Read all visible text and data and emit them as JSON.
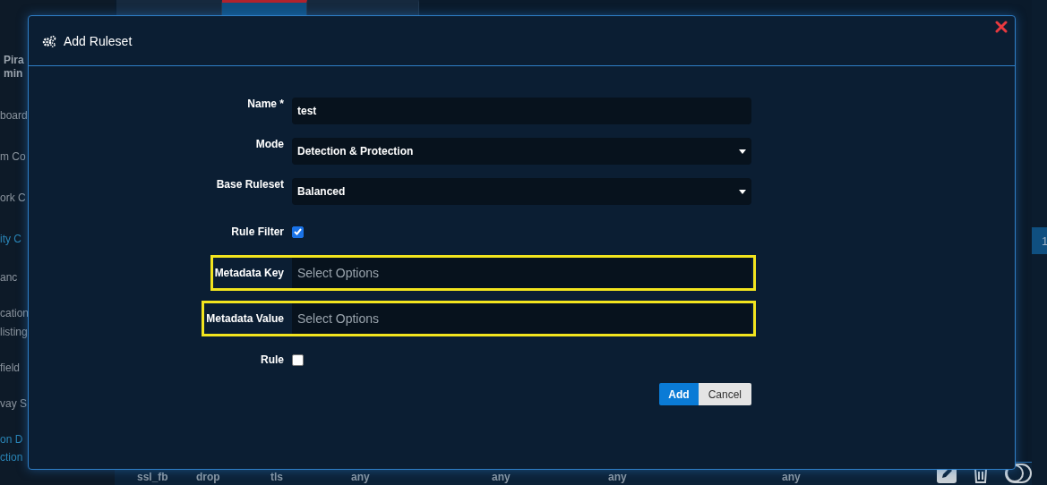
{
  "tabs": [
    {
      "selected": false
    },
    {
      "selected": true
    },
    {
      "selected": false
    }
  ],
  "sidebar": {
    "profile": [
      "Pira",
      "min"
    ],
    "items": [
      {
        "label": "board",
        "active": false
      },
      {
        "label": "m Co",
        "active": false
      },
      {
        "label": "ork C",
        "active": false
      },
      {
        "label": "ity C",
        "active": true
      },
      {
        "label": "anc",
        "active": false
      },
      {
        "label": "cation",
        "active": false
      },
      {
        "label": "listing",
        "active": false
      },
      {
        "label": "field",
        "active": false
      },
      {
        "label": "vay S",
        "active": false
      },
      {
        "label": "on D",
        "active": true
      },
      {
        "label": "ction",
        "active": true
      }
    ]
  },
  "table": {
    "rows": [
      {
        "cells": [
          "ssl_fb",
          "drop",
          "tls",
          "any",
          "any",
          "any",
          "any"
        ],
        "enabled": false
      }
    ]
  },
  "pagination": {
    "pages": [
      {
        "label": "1",
        "selected": true
      }
    ]
  },
  "modal": {
    "title": "Add Ruleset",
    "fields": [
      {
        "kind": "text",
        "label": "Name *",
        "value": "test",
        "highlighted": false
      },
      {
        "kind": "select",
        "label": "Mode",
        "value": "Detection & Protection",
        "highlighted": false
      },
      {
        "kind": "select",
        "label": "Base Ruleset",
        "value": "Balanced",
        "highlighted": false
      },
      {
        "kind": "checkbox",
        "label": "Rule Filter",
        "checked": true,
        "highlighted": false
      },
      {
        "kind": "multiselect",
        "label": "Metadata Key",
        "placeholder": "Select Options",
        "highlighted": true
      },
      {
        "kind": "multiselect",
        "label": "Metadata Value",
        "placeholder": "Select Options",
        "highlighted": true
      },
      {
        "kind": "checkbox",
        "label": "Rule",
        "checked": false,
        "highlighted": false
      }
    ],
    "buttons": [
      {
        "label": "Add",
        "kind": "primary"
      },
      {
        "label": "Cancel",
        "kind": "secondary"
      }
    ]
  }
}
